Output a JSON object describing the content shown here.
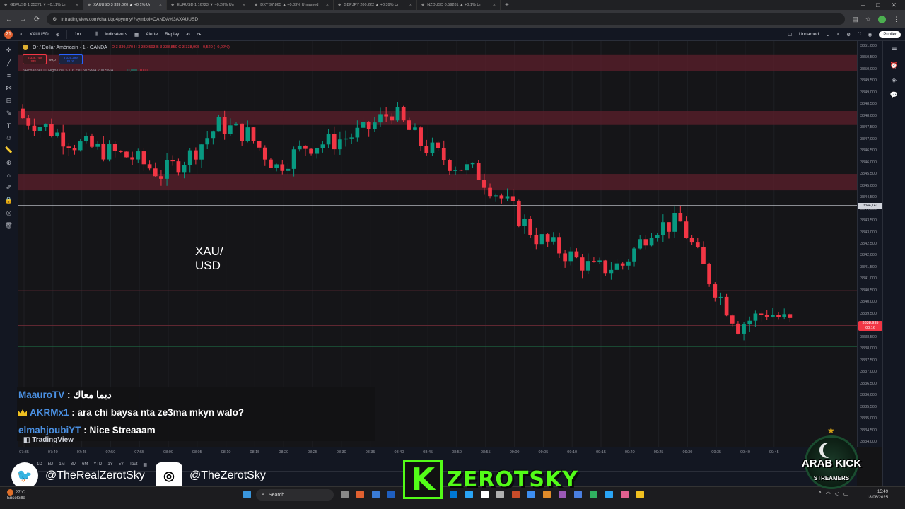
{
  "browser": {
    "tabs": [
      {
        "label": "GBPUSD 1,35371 ▼ −0,11% Un"
      },
      {
        "label": "XAUUSD 3 339,020 ▲ +0,1% Un"
      },
      {
        "label": "EURUSD 1,16723 ▼ −0,28% Un"
      },
      {
        "label": "DXY 97,865 ▲ +0,03% Unnamed"
      },
      {
        "label": "GBPJPY 200,222 ▲ +0,39% Un"
      },
      {
        "label": "NZDUSD 0,59281 ▲ +0,1% Un"
      }
    ],
    "url": "fr.tradingview.com/chart/qq4pynmy/?symbol=OANDA%3AXAUUSD"
  },
  "toolbar": {
    "symbol": "XAUUSD",
    "interval": "1m",
    "indicators_label": "Indicateurs",
    "alert_label": "Alerte",
    "replay_label": "Replay",
    "layout_name": "Unnamed",
    "publish_label": "Publier",
    "avatar_badge": "21"
  },
  "legend": {
    "title": "Or / Dollar Américain · 1 · OANDA",
    "ohlc": "O 3 339,670 H 3 339,593 B 3 338,850 C 3 338,995 −0,520 (−0,02%)",
    "sell_price": "3 338,749",
    "sell_label": "SELL",
    "spread": "99,0",
    "buy_price": "3 339,299",
    "buy_label": "BUY",
    "indicator_name": "SRchannel 10 High/Low 5 1 6 290 50 SMA 200 SMA",
    "indicator_val1": "0,000",
    "indicator_val2": "0,000"
  },
  "overlay_label": {
    "line1": "XAU/",
    "line2": "USD"
  },
  "price_axis": {
    "labels": [
      "3351,000",
      "3350,500",
      "3350,000",
      "3349,500",
      "3349,000",
      "3348,500",
      "3348,000",
      "3347,500",
      "3347,000",
      "3346,500",
      "3346,000",
      "3345,500",
      "3345,000",
      "3344,500",
      "3344,000",
      "3343,500",
      "3343,000",
      "3342,500",
      "3342,000",
      "3341,500",
      "3341,000",
      "3340,500",
      "3340,000",
      "3339,500",
      "3339,000",
      "3338,500",
      "3338,000",
      "3337,500",
      "3337,000",
      "3336,500",
      "3336,000",
      "3335,500",
      "3335,000",
      "3334,500",
      "3334,000"
    ],
    "current_price": "3338,995",
    "countdown": "00:16",
    "line_price": "3344,141"
  },
  "time_axis": {
    "labels": [
      "07:35",
      "07:40",
      "07:45",
      "07:50",
      "07:55",
      "08:00",
      "08:05",
      "08:10",
      "08:15",
      "08:20",
      "08:25",
      "08:30",
      "08:35",
      "08:40",
      "08:45",
      "08:50",
      "08:55",
      "09:00",
      "09:05",
      "09:10",
      "09:15",
      "09:20",
      "09:25",
      "09:30",
      "09:35",
      "09:40",
      "09:45"
    ]
  },
  "range_bar": {
    "items": [
      "1D",
      "5D",
      "1M",
      "3M",
      "6M",
      "YTD",
      "1Y",
      "5Y",
      "Tout"
    ],
    "utc": "UTC-4"
  },
  "chat": [
    {
      "user": "MaauroTV",
      "message": "ديما معاك",
      "crown": false
    },
    {
      "user": "AKRMx1",
      "message": "ara chi baysa nta ze3ma mkyn walo?",
      "crown": true
    },
    {
      "user": "elmahjoubiYT",
      "message": "Nice Streaaam",
      "crown": false
    }
  ],
  "watermark": "TradingView",
  "social": {
    "twitter": "@TheRealZerotSky",
    "instagram": "@TheZerotSky"
  },
  "stream_logo": {
    "letter": "K",
    "name": "ZEROTSKY"
  },
  "badge": {
    "line1": "ARAB KICK",
    "line2": "STREAMERS"
  },
  "taskbar": {
    "weather_temp": "27°C",
    "weather_desc": "Ensoleillé",
    "search_label": "Search",
    "time": "15:49",
    "date": "18/08/2025"
  },
  "colors": {
    "up": "#089981",
    "down": "#f23645",
    "zone": "#5c1f2b",
    "accent": "#2962ff",
    "kick_green": "#53fc18"
  },
  "chart_data": {
    "type": "candlestick",
    "x": [
      "07:35",
      "07:40",
      "07:45",
      "07:50",
      "07:55",
      "08:00",
      "08:05",
      "08:10",
      "08:15",
      "08:20",
      "08:25",
      "08:30",
      "08:35",
      "08:40",
      "08:45",
      "08:50",
      "08:55",
      "09:00",
      "09:05",
      "09:10",
      "09:15",
      "09:20",
      "09:25",
      "09:30",
      "09:35",
      "09:40",
      "09:45",
      "09:50"
    ],
    "close": [
      3348.0,
      3347.5,
      3346.8,
      3346.5,
      3346.2,
      3345.5,
      3346.3,
      3347.6,
      3347.2,
      3345.8,
      3346.7,
      3346.9,
      3347.3,
      3348.2,
      3346.8,
      3346.0,
      3345.5,
      3344.2,
      3342.8,
      3342.1,
      3341.4,
      3341.6,
      3343.2,
      3343.4,
      3341.0,
      3339.0,
      3339.6,
      3338.995
    ],
    "ylim": [
      3333.8,
      3351.2
    ],
    "zones": [
      [
        3349.9,
        3350.6
      ],
      [
        3347.6,
        3348.2
      ],
      [
        3344.8,
        3345.5
      ]
    ],
    "lines": [
      3344.141,
      3340.5,
      3339.0,
      3338.1
    ]
  }
}
